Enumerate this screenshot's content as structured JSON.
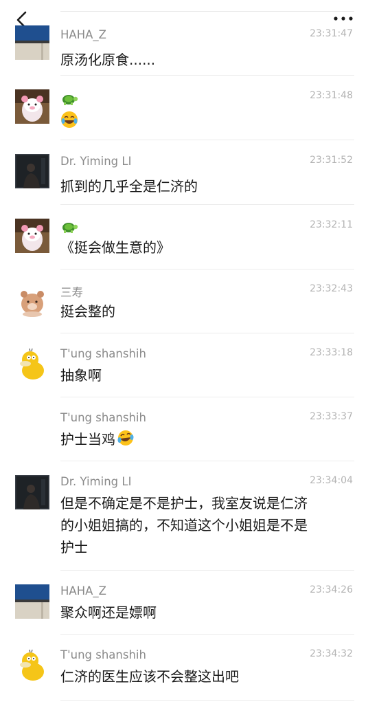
{
  "nav": {
    "back_icon": "chevron-left-icon",
    "more_icon": "more-dots-icon"
  },
  "messages": [
    {
      "name": "HAHA_Z",
      "time": "23:31:47",
      "text": "原汤化原食......",
      "avatar": "blue-photo-avatar"
    },
    {
      "name": "",
      "time": "23:31:48",
      "text": "",
      "avatar": "pink-pig-avatar",
      "badge": "turtle-icon",
      "emoji": "laughing-tears-emoji"
    },
    {
      "name": "Dr. Yiming LI",
      "time": "23:31:52",
      "text": "抓到的几乎全是仁济的",
      "avatar": "dark-photo-avatar"
    },
    {
      "name": "",
      "time": "23:32:11",
      "text": "《挺会做生意的》",
      "avatar": "pink-pig-avatar",
      "badge": "turtle-icon"
    },
    {
      "name": "三寿",
      "time": "23:32:43",
      "text": "挺会整的",
      "avatar": "bear-avatar"
    },
    {
      "name": "T'ung shanshih",
      "time": "23:33:18",
      "text": "抽象啊",
      "avatar": "psyduck-avatar"
    },
    {
      "name": "T'ung shanshih",
      "time": "23:33:37",
      "text": "护士当鸡",
      "avatar": "",
      "emoji": "laughing-tears-emoji"
    },
    {
      "name": "Dr. Yiming LI",
      "time": "23:34:04",
      "text_lines": [
        "但是不确定是不是护士，我室友说是仁济",
        "的小姐姐搞的，不知道这个小姐姐是不是",
        "护士"
      ],
      "avatar": "dark-photo-avatar"
    },
    {
      "name": "HAHA_Z",
      "time": "23:34:26",
      "text": "聚众啊还是嫖啊",
      "avatar": "blue-photo-avatar"
    },
    {
      "name": "T'ung shanshih",
      "time": "23:34:32",
      "text": "仁济的医生应该不会整这出吧",
      "avatar": "psyduck-avatar"
    }
  ]
}
